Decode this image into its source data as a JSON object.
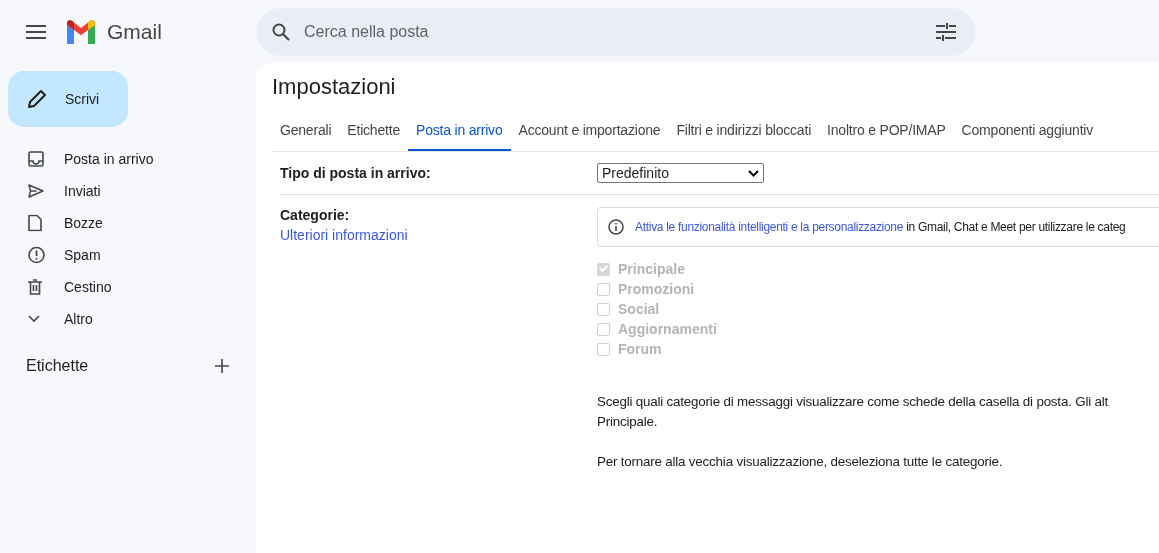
{
  "app": {
    "name": "Gmail"
  },
  "search": {
    "placeholder": "Cerca nella posta"
  },
  "compose": {
    "label": "Scrivi"
  },
  "sidebar": {
    "items": [
      {
        "label": "Posta in arrivo",
        "kind": "inbox"
      },
      {
        "label": "Inviati",
        "kind": "sent"
      },
      {
        "label": "Bozze",
        "kind": "drafts"
      },
      {
        "label": "Spam",
        "kind": "spam"
      },
      {
        "label": "Cestino",
        "kind": "trash"
      },
      {
        "label": "Altro",
        "kind": "more"
      }
    ],
    "labels_heading": "Etichette"
  },
  "settings": {
    "title": "Impostazioni",
    "tabs": [
      {
        "label": "Generali",
        "selected": false
      },
      {
        "label": "Etichette",
        "selected": false
      },
      {
        "label": "Posta in arrivo",
        "selected": true
      },
      {
        "label": "Account e importazione",
        "selected": false
      },
      {
        "label": "Filtri e indirizzi bloccati",
        "selected": false
      },
      {
        "label": "Inoltro e POP/IMAP",
        "selected": false
      },
      {
        "label": "Componenti aggiuntiv",
        "selected": false
      }
    ],
    "inbox_type": {
      "label": "Tipo di posta in arrivo:",
      "value": "Predefinito"
    },
    "categories": {
      "label": "Categorie:",
      "link": "Ulteriori informazioni",
      "notice": {
        "link": "Attiva le funzionalità intelligenti e la personalizzazione",
        "text": " in Gmail, Chat e Meet per utilizzare le categ"
      },
      "options": [
        {
          "label": "Principale",
          "checked": true,
          "disabled": true
        },
        {
          "label": "Promozioni",
          "checked": false,
          "disabled": true
        },
        {
          "label": "Social",
          "checked": false,
          "disabled": true
        },
        {
          "label": "Aggiornamenti",
          "checked": false,
          "disabled": true
        },
        {
          "label": "Forum",
          "checked": false,
          "disabled": true
        }
      ],
      "description": [
        "Scegli quali categorie di messaggi visualizzare come schede della casella di posta. Gli alt",
        "Principale."
      ],
      "note": "Per tornare alla vecchia visualizzazione, deseleziona tutte le categorie."
    }
  }
}
